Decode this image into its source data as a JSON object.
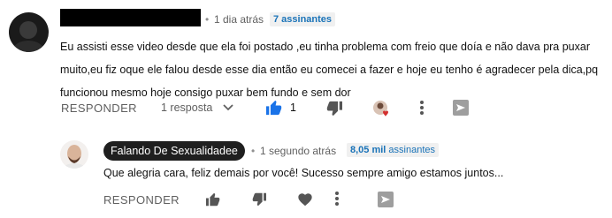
{
  "comment": {
    "time": "1 dia atrás",
    "subscriber_badge": "7 assinantes",
    "text": "Eu assisti esse video desde que ela foi postado ,eu tinha problema com freio que doía e não dava pra puxar muito,eu fiz oque ele falou desde esse dia então eu comecei a fazer e hoje eu tenho é agradecer pela dica,pq funcionou mesmo hoje consigo puxar bem fundo e sem dor",
    "reply_label": "RESPONDER",
    "replies_label": "1 resposta",
    "likes": "1"
  },
  "reply": {
    "author": "Falando De Sexualidadee",
    "time": "1 segundo atrás",
    "subscriber_count": "8,05 mil",
    "subscriber_suffix": "assinantes",
    "text": "Que alegria cara, feliz demais por você! Sucesso sempre amigo estamos juntos...",
    "reply_label": "RESPONDER"
  },
  "colors": {
    "like_active": "#1a73e8",
    "heart": "#d32f2f",
    "badge_text": "#1a73b8"
  }
}
